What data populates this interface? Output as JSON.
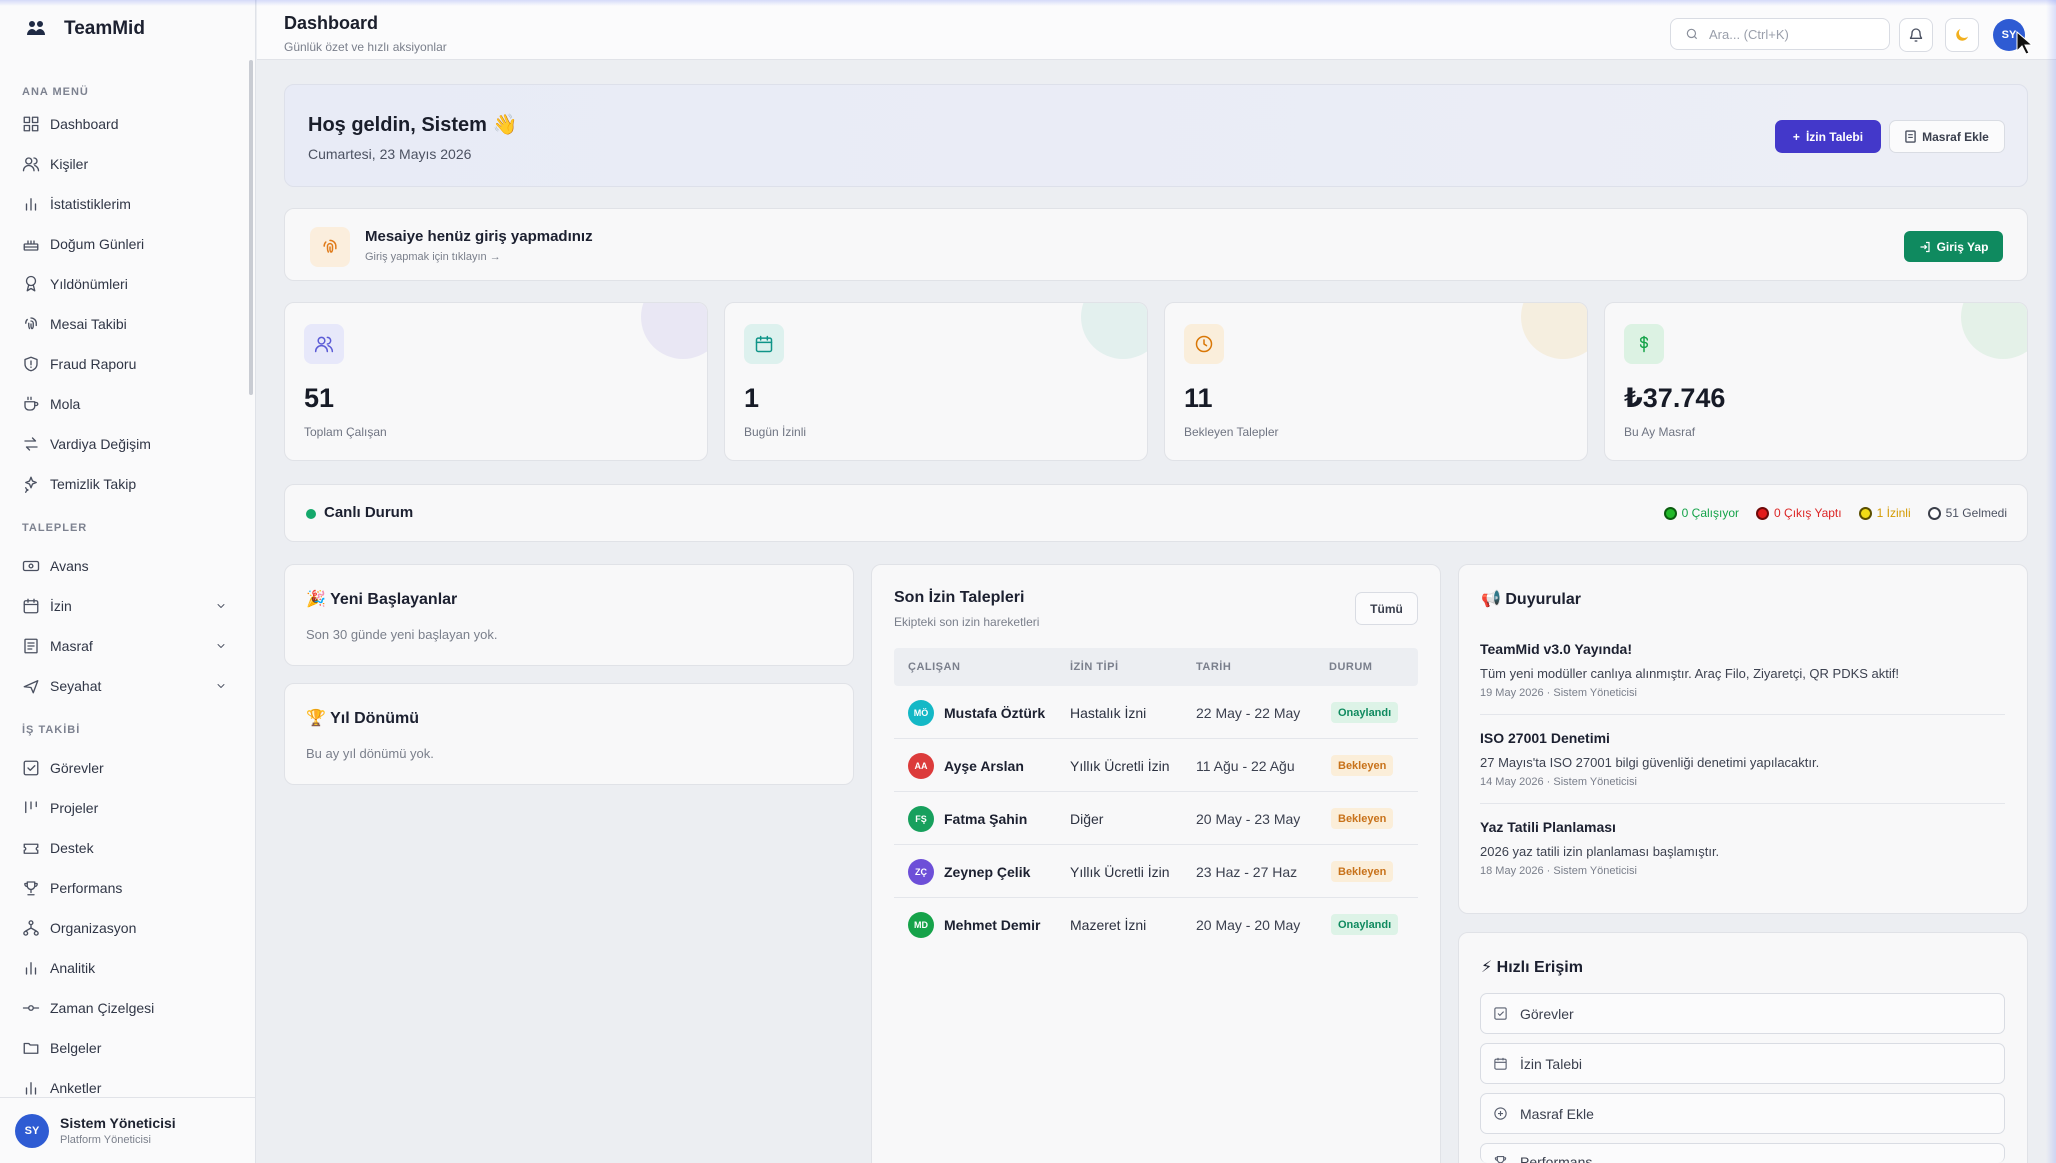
{
  "app": {
    "name": "TeamMid"
  },
  "header": {
    "title": "Dashboard",
    "subtitle": "Günlük özet ve hızlı aksiyonlar",
    "search_placeholder": "Ara... (Ctrl+K)",
    "avatar_initials": "SY"
  },
  "sidebar": {
    "sections": [
      {
        "title": "ANA MENÜ",
        "items": [
          {
            "label": "Dashboard",
            "icon": "grid-icon"
          },
          {
            "label": "Kişiler",
            "icon": "users-icon"
          },
          {
            "label": "İstatistiklerim",
            "icon": "bar-chart-icon"
          },
          {
            "label": "Doğum Günleri",
            "icon": "cake-icon"
          },
          {
            "label": "Yıldönümleri",
            "icon": "award-icon"
          },
          {
            "label": "Mesai Takibi",
            "icon": "fingerprint-icon"
          },
          {
            "label": "Fraud Raporu",
            "icon": "shield-icon"
          },
          {
            "label": "Mola",
            "icon": "coffee-icon"
          },
          {
            "label": "Vardiya Değişim",
            "icon": "swap-icon"
          },
          {
            "label": "Temizlik Takip",
            "icon": "sparkles-icon"
          }
        ]
      },
      {
        "title": "TALEPLER",
        "items": [
          {
            "label": "Avans",
            "icon": "banknote-icon"
          },
          {
            "label": "İzin",
            "icon": "calendar-icon",
            "expandable": true
          },
          {
            "label": "Masraf",
            "icon": "receipt-icon",
            "expandable": true
          },
          {
            "label": "Seyahat",
            "icon": "plane-icon",
            "expandable": true
          }
        ]
      },
      {
        "title": "İŞ TAKİBİ",
        "items": [
          {
            "label": "Görevler",
            "icon": "check-square-icon"
          },
          {
            "label": "Projeler",
            "icon": "kanban-icon"
          },
          {
            "label": "Destek",
            "icon": "ticket-icon"
          },
          {
            "label": "Performans",
            "icon": "trophy-icon"
          },
          {
            "label": "Organizasyon",
            "icon": "org-chart-icon"
          },
          {
            "label": "Analitik",
            "icon": "bar-chart-icon"
          },
          {
            "label": "Zaman Çizelgesi",
            "icon": "timeline-icon"
          },
          {
            "label": "Belgeler",
            "icon": "folder-icon"
          },
          {
            "label": "Anketler",
            "icon": "bar-chart-icon"
          }
        ]
      }
    ],
    "user": {
      "initials": "SY",
      "name": "Sistem Yöneticisi",
      "role": "Platform Yöneticisi"
    }
  },
  "welcome": {
    "title": "Hoş geldin, Sistem 👋",
    "date": "Cumartesi, 23 Mayıs 2026",
    "primary_button": "İzin Talebi",
    "secondary_button": "Masraf Ekle"
  },
  "checkin": {
    "title": "Mesaiye henüz giriş yapmadınız",
    "subtitle": "Giriş yapmak için tıklayın →",
    "button": "Giriş Yap"
  },
  "stats": [
    {
      "value": "51",
      "label": "Toplam Çalışan",
      "icon": "users-icon",
      "color": "#5b5bd6"
    },
    {
      "value": "1",
      "label": "Bugün İzinli",
      "icon": "calendar-icon",
      "color": "#0f9488"
    },
    {
      "value": "11",
      "label": "Bekleyen Talepler",
      "icon": "clock-icon",
      "color": "#d97706"
    },
    {
      "value": "₺37.746",
      "label": "Bu Ay Masraf",
      "icon": "dollar-icon",
      "color": "#16a34a"
    }
  ],
  "live": {
    "title": "Canlı Durum",
    "working": "0 Çalışıyor",
    "left": "0 Çıkış Yaptı",
    "on_leave": "1 İzinli",
    "absent": "51 Gelmedi"
  },
  "newcomers": {
    "title": "🎉 Yeni Başlayanlar",
    "empty": "Son 30 günde yeni başlayan yok."
  },
  "anniversary": {
    "title": "🏆 Yıl Dönümü",
    "empty": "Bu ay yıl dönümü yok."
  },
  "leave_requests": {
    "title": "Son İzin Talepleri",
    "subtitle": "Ekipteki son izin hareketleri",
    "all_button": "Tümü",
    "columns": [
      "ÇALIŞAN",
      "İZİN TİPİ",
      "TARİH",
      "DURUM"
    ],
    "rows": [
      {
        "initials": "MÖ",
        "color": "#14b8c6",
        "name": "Mustafa Öztürk",
        "type": "Hastalık İzni",
        "date": "22 May - 22 May",
        "status": "Onaylandı",
        "status_kind": "ok"
      },
      {
        "initials": "AA",
        "color": "#dc3b3b",
        "name": "Ayşe Arslan",
        "type": "Yıllık Ücretli İzin",
        "date": "11 Ağu - 22 Ağu",
        "status": "Bekleyen",
        "status_kind": "wait"
      },
      {
        "initials": "FŞ",
        "color": "#17a05d",
        "name": "Fatma Şahin",
        "type": "Diğer",
        "date": "20 May - 23 May",
        "status": "Bekleyen",
        "status_kind": "wait"
      },
      {
        "initials": "ZÇ",
        "color": "#6d4fd8",
        "name": "Zeynep Çelik",
        "type": "Yıllık Ücretli İzin",
        "date": "23 Haz - 27 Haz",
        "status": "Bekleyen",
        "status_kind": "wait"
      },
      {
        "initials": "MD",
        "color": "#16a34a",
        "name": "Mehmet Demir",
        "type": "Mazeret İzni",
        "date": "20 May - 20 May",
        "status": "Onaylandı",
        "status_kind": "ok"
      }
    ]
  },
  "announcements": {
    "title": "📢 Duyurular",
    "items": [
      {
        "title": "TeamMid v3.0 Yayında!",
        "body": "Tüm yeni modüller canlıya alınmıştır. Araç Filo, Ziyaretçi, QR PDKS aktif!",
        "meta": "19 May 2026 · Sistem Yöneticisi"
      },
      {
        "title": "ISO 27001 Denetimi",
        "body": "27 Mayıs'ta ISO 27001 bilgi güvenliği denetimi yapılacaktır.",
        "meta": "14 May 2026 · Sistem Yöneticisi"
      },
      {
        "title": "Yaz Tatili Planlaması",
        "body": "2026 yaz tatili izin planlaması başlamıştır.",
        "meta": "18 May 2026 · Sistem Yöneticisi"
      }
    ]
  },
  "quick_access": {
    "title": "⚡ Hızlı Erişim",
    "items": [
      "Görevler",
      "İzin Talebi",
      "Masraf Ekle",
      "Performans"
    ]
  }
}
